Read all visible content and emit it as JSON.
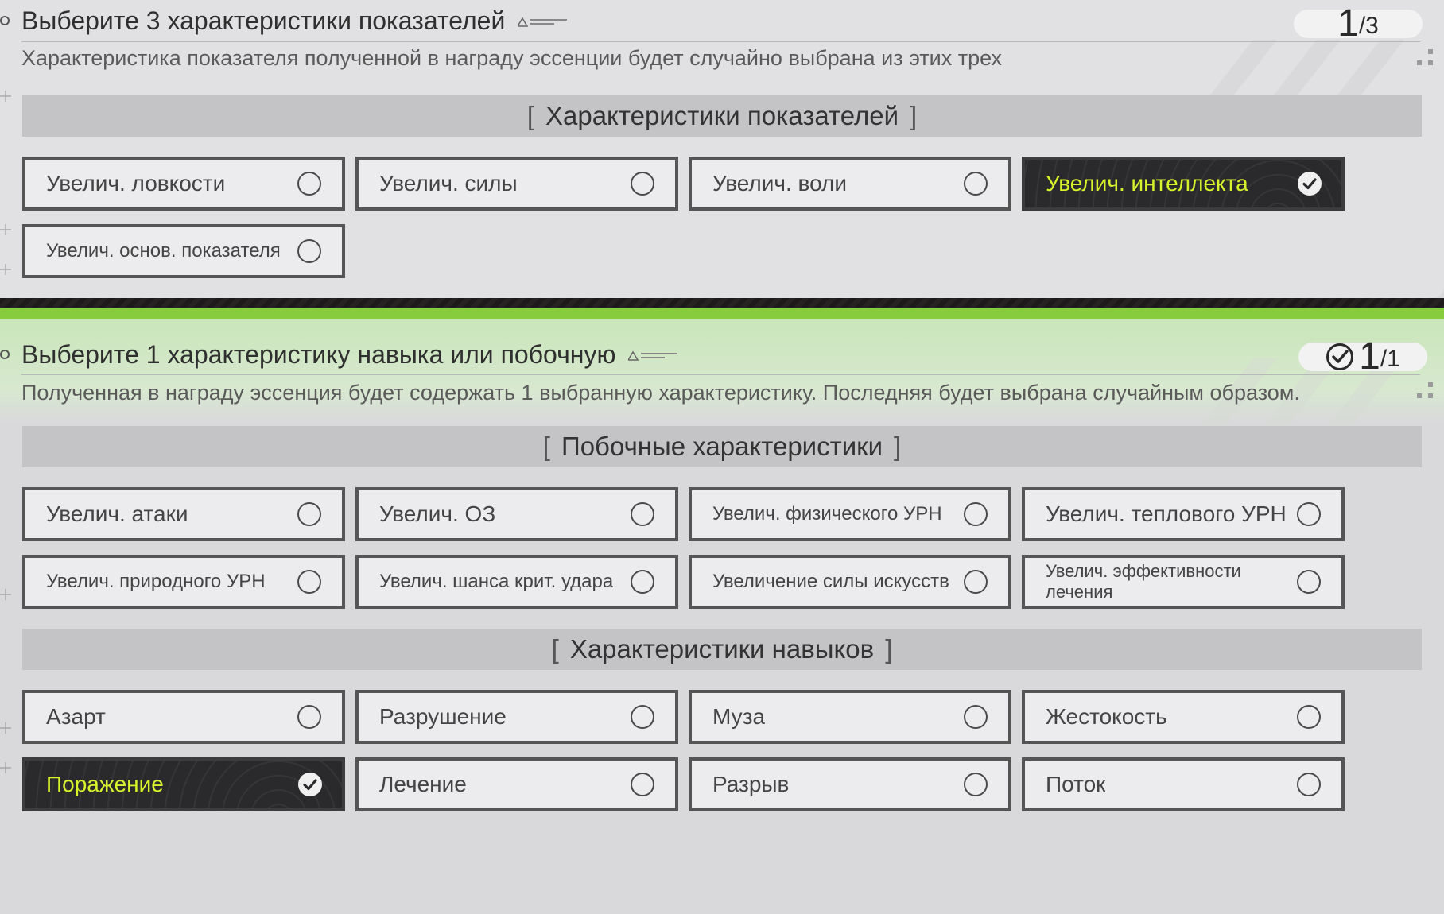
{
  "colors": {
    "accent_green": "#86cc3c",
    "selected_text": "#d8f22c",
    "selected_bg": "#2a2a2c"
  },
  "stat_section": {
    "title": "Выберите 3 характеристики показателей",
    "counter_current": "1",
    "counter_total": "/3",
    "description": "Характеристика показателя полученной в награду эссенции будет случайно выбрана из этих трех",
    "category_title": "Характеристики показателей",
    "options": [
      {
        "label": "Увелич. ловкости",
        "selected": false
      },
      {
        "label": "Увелич. силы",
        "selected": false
      },
      {
        "label": "Увелич. воли",
        "selected": false
      },
      {
        "label": "Увелич. интеллекта",
        "selected": true
      },
      {
        "label": "Увелич. основ. показателя",
        "selected": false
      }
    ]
  },
  "skill_section": {
    "title": "Выберите 1 характеристику навыка или побочную",
    "counter_current": "1",
    "counter_total": "/1",
    "description": "Полученная в награду эссенция будет содержать 1 выбранную характеристику. Последняя будет выбрана случайным образом.",
    "secondary_category_title": "Побочные характеристики",
    "secondary_options": [
      {
        "label": "Увелич. атаки",
        "selected": false
      },
      {
        "label": "Увелич. ОЗ",
        "selected": false
      },
      {
        "label": "Увелич. физического УРН",
        "selected": false
      },
      {
        "label": "Увелич. теплового УРН",
        "selected": false
      },
      {
        "label": "Увелич. природного УРН",
        "selected": false
      },
      {
        "label": "Увелич. шанса крит. удара",
        "selected": false
      },
      {
        "label": "Увеличение силы искусств",
        "selected": false
      },
      {
        "label": "Увелич. эффективности лечения",
        "selected": false
      }
    ],
    "skill_category_title": "Характеристики навыков",
    "skill_options": [
      {
        "label": "Азарт",
        "selected": false
      },
      {
        "label": "Разрушение",
        "selected": false
      },
      {
        "label": "Муза",
        "selected": false
      },
      {
        "label": "Жестокость",
        "selected": false
      },
      {
        "label": "Поражение",
        "selected": true
      },
      {
        "label": "Лечение",
        "selected": false
      },
      {
        "label": "Разрыв",
        "selected": false
      },
      {
        "label": "Поток",
        "selected": false
      }
    ]
  }
}
